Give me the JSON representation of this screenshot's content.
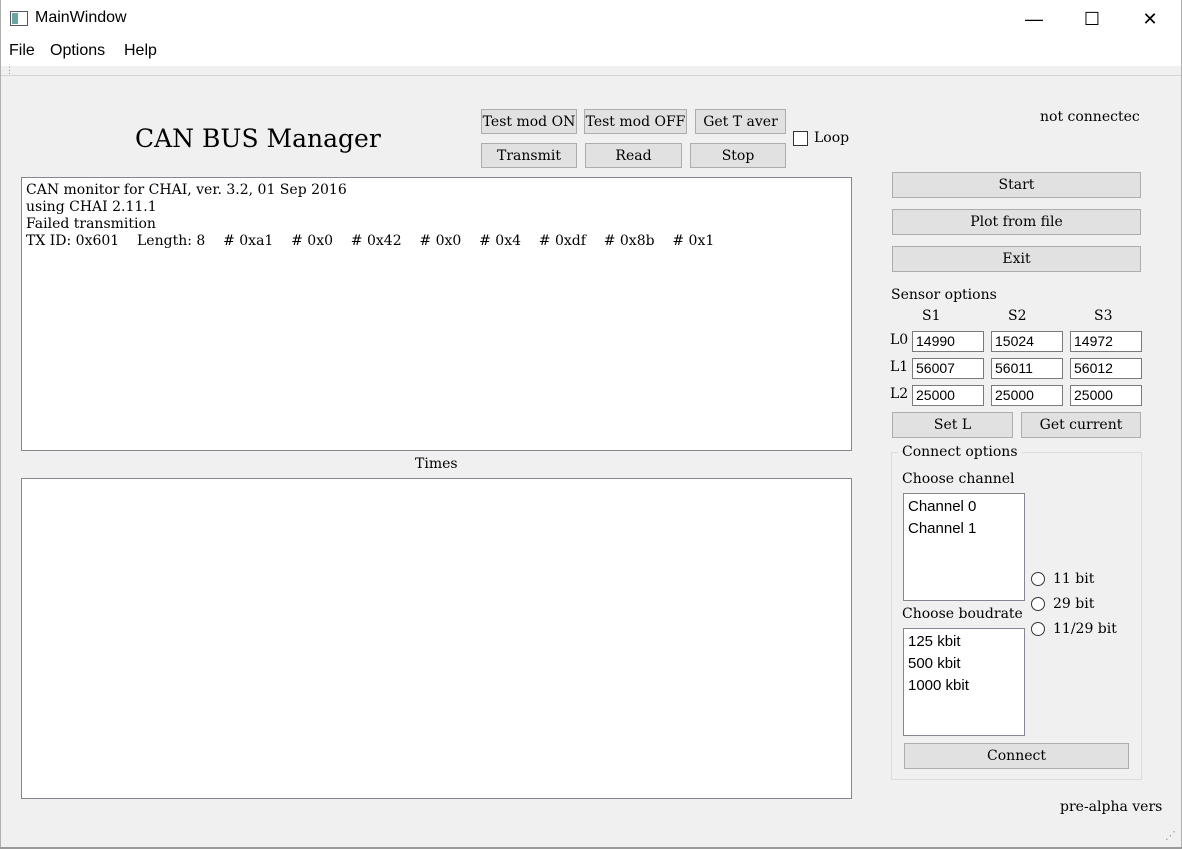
{
  "window": {
    "title": "MainWindow",
    "minimize": "—",
    "maximize": "☐",
    "close": "✕"
  },
  "menu": [
    "File",
    "Options",
    "Help"
  ],
  "header": {
    "title": "CAN BUS Manager",
    "status": "not connectec"
  },
  "buttons": {
    "test_on": "Test mod ON",
    "test_off": "Test mod OFF",
    "get_t": "Get T aver",
    "transmit": "Transmit",
    "read": "Read",
    "stop": "Stop",
    "loop": "Loop",
    "start": "Start",
    "plot": "Plot from file",
    "exit": "Exit",
    "set_l": "Set L",
    "get_current": "Get current",
    "connect": "Connect"
  },
  "log": [
    "CAN monitor for CHAI, ver. 3.2, 01 Sep 2016",
    "using CHAI 2.11.1",
    "Failed transmition",
    "TX ID: 0x601    Length: 8    # 0xa1    # 0x0    # 0x42    # 0x0    # 0x4    # 0xdf    # 0x8b    # 0x1"
  ],
  "times_label": "Times",
  "sensor": {
    "title": "Sensor options",
    "columns": [
      "S1",
      "S2",
      "S3"
    ],
    "rows": [
      {
        "label": "L0",
        "values": [
          "14990",
          "15024",
          "14972"
        ]
      },
      {
        "label": "L1",
        "values": [
          "56007",
          "56011",
          "56012"
        ]
      },
      {
        "label": "L2",
        "values": [
          "25000",
          "25000",
          "25000"
        ]
      }
    ]
  },
  "connect": {
    "title": "Connect options",
    "channel_label": "Choose channel",
    "channels": [
      "Channel 0",
      "Channel 1"
    ],
    "boudrate_label": "Choose boudrate",
    "boudrates": [
      "125 kbit",
      "500 kbit",
      "1000 kbit"
    ],
    "bits": [
      "11 bit",
      "29 bit",
      "11/29 bit"
    ]
  },
  "footer": "pre-alpha vers"
}
